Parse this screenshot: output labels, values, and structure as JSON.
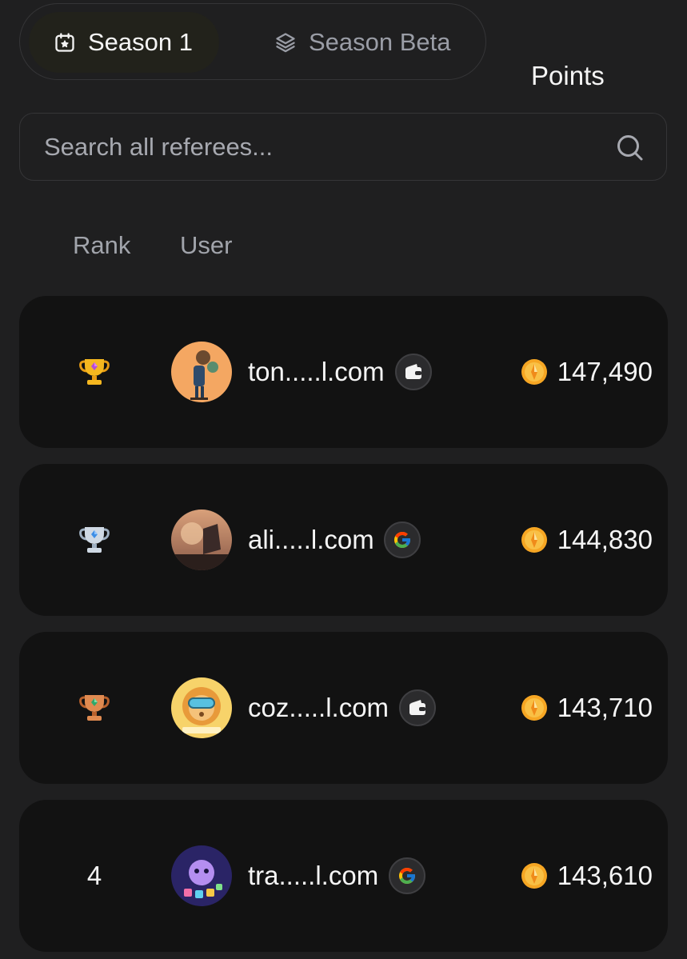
{
  "tabs": [
    {
      "label": "Season 1",
      "icon": "calendar-star-icon",
      "active": true
    },
    {
      "label": "Season Beta",
      "icon": "layers-icon",
      "active": false
    }
  ],
  "search": {
    "placeholder": "Search all referees...",
    "icon": "search-icon"
  },
  "table": {
    "headers": {
      "rank": "Rank",
      "user": "User",
      "points": "Points"
    },
    "rows": [
      {
        "rank": "1",
        "rank_icon": "gold-trophy-icon",
        "name": "ton.....l.com",
        "login": "wallet-icon",
        "points": "147,490"
      },
      {
        "rank": "2",
        "rank_icon": "silver-trophy-icon",
        "name": "ali.....l.com",
        "login": "google-icon",
        "points": "144,830"
      },
      {
        "rank": "3",
        "rank_icon": "bronze-trophy-icon",
        "name": "coz.....l.com",
        "login": "wallet-icon",
        "points": "143,710"
      },
      {
        "rank": "4",
        "rank_icon": "",
        "name": "tra.....l.com",
        "login": "google-icon",
        "points": "143,610"
      }
    ]
  },
  "colors": {
    "background": "#1f1f20",
    "row": "#121212",
    "gold": "#f2b21c",
    "silver": "#c9d3de",
    "bronze": "#d8824a",
    "coin": "#f6a623"
  }
}
